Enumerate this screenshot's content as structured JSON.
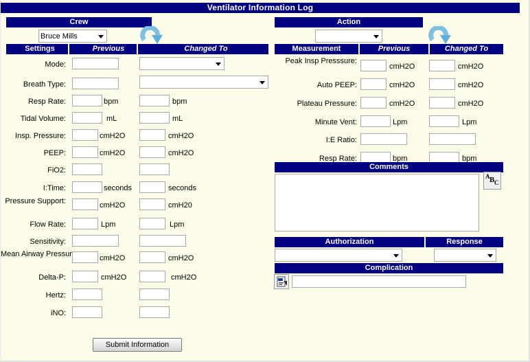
{
  "window": {
    "title": "Ventilator Information Log"
  },
  "crew": {
    "header": "Crew",
    "selected": "Bruce Mills",
    "refresh_icon": "refresh-arrow-icon"
  },
  "action": {
    "header": "Action",
    "selected": "",
    "refresh_icon": "refresh-arrow-icon"
  },
  "settings_table": {
    "headers": {
      "label": "Settings",
      "previous": "Previous",
      "changed": "Changed To"
    },
    "rows": [
      {
        "label": "Mode:",
        "prev_kind": "text",
        "prev_unit": "",
        "chg_kind": "select",
        "chg_unit": "",
        "chg_value": ""
      },
      {
        "label": "Breath Type:",
        "prev_kind": "text",
        "prev_unit": "",
        "chg_kind": "select",
        "chg_unit": "",
        "chg_value": ""
      },
      {
        "label": "Resp Rate:",
        "prev_kind": "text",
        "prev_unit": "bpm",
        "chg_kind": "text",
        "chg_unit": "bpm",
        "chg_value": ""
      },
      {
        "label": "Tidal Volume:",
        "prev_kind": "text",
        "prev_unit": "mL",
        "chg_kind": "text",
        "chg_unit": "mL",
        "chg_value": ""
      },
      {
        "label": "Insp. Pressure:",
        "prev_kind": "text",
        "prev_unit": "cmH2O",
        "chg_kind": "text",
        "chg_unit": "cmH2O",
        "chg_value": ""
      },
      {
        "label": "PEEP:",
        "prev_kind": "text",
        "prev_unit": "cmH2O",
        "chg_kind": "text",
        "chg_unit": "cmH2O",
        "chg_value": ""
      },
      {
        "label": "FiO2:",
        "prev_kind": "text",
        "prev_unit": "",
        "chg_kind": "text",
        "chg_unit": "",
        "chg_value": ""
      },
      {
        "label": "I:Time:",
        "prev_kind": "text",
        "prev_unit": "seconds",
        "chg_kind": "text",
        "chg_unit": "seconds",
        "chg_value": ""
      },
      {
        "label": "Pressure Support:",
        "prev_kind": "text",
        "prev_unit": "cmH2O",
        "chg_kind": "text",
        "chg_unit": "cmH20",
        "chg_value": ""
      },
      {
        "label": "Flow Rate:",
        "prev_kind": "text",
        "prev_unit": "Lpm",
        "chg_kind": "text",
        "chg_unit": "Lpm",
        "chg_value": ""
      },
      {
        "label": "Sensitivity:",
        "prev_kind": "wide",
        "prev_unit": "",
        "chg_kind": "wide",
        "chg_unit": "",
        "chg_value": ""
      },
      {
        "label": "Mean Airway Pressure:",
        "prev_kind": "text",
        "prev_unit": "cmH2O",
        "chg_kind": "text",
        "chg_unit": "cmH2O",
        "chg_value": ""
      },
      {
        "label": "Delta-P:",
        "prev_kind": "text",
        "prev_unit": "cmH2O",
        "chg_kind": "text",
        "chg_unit": "cmH2O",
        "chg_value": ""
      },
      {
        "label": "Hertz:",
        "prev_kind": "text",
        "prev_unit": "",
        "chg_kind": "text",
        "chg_unit": "",
        "chg_value": ""
      },
      {
        "label": "iNO:",
        "prev_kind": "text",
        "prev_unit": "",
        "chg_kind": "text",
        "chg_unit": "",
        "chg_value": ""
      }
    ]
  },
  "measurement_table": {
    "headers": {
      "label": "Measurement",
      "previous": "Previous",
      "changed": "Changed To"
    },
    "rows": [
      {
        "label": "Peak Insp Presssure:",
        "prev_unit": "cmH2O",
        "chg_unit": "cmH2O",
        "prev_kind": "text",
        "chg_kind": "text"
      },
      {
        "label": "Auto PEEP:",
        "prev_unit": "cmH2O",
        "chg_unit": "cmH2O",
        "prev_kind": "text",
        "chg_kind": "text"
      },
      {
        "label": "Plateau Pressure:",
        "prev_unit": "cmH2O",
        "chg_unit": "cmH2O",
        "prev_kind": "text",
        "chg_kind": "text"
      },
      {
        "label": "Minute Vent:",
        "prev_unit": "Lpm",
        "chg_unit": "Lpm",
        "prev_kind": "text",
        "chg_kind": "text"
      },
      {
        "label": "I:E Ratio:",
        "prev_unit": "",
        "chg_unit": "",
        "prev_kind": "wide",
        "chg_kind": "wide"
      },
      {
        "label": "Resp Rate:",
        "prev_unit": "bpm",
        "chg_unit": "bpm",
        "prev_kind": "text",
        "chg_kind": "text"
      }
    ]
  },
  "comments": {
    "header": "Comments",
    "value": "",
    "spellcheck_icon": "abc-spellcheck-icon",
    "spellcheck_letters": {
      "a": "A",
      "b": "B",
      "c": "C"
    }
  },
  "authorization": {
    "header": "Authorization",
    "selected": ""
  },
  "response": {
    "header": "Response",
    "selected": ""
  },
  "complication": {
    "header": "Complication",
    "value": "",
    "picker_icon": "complication-picker-icon"
  },
  "submit": {
    "label": "Submit Information"
  },
  "colors": {
    "header_blue": "#000080",
    "page_background": "#fbfbe8",
    "header_text": "#ffffff",
    "field_border": "#a8a8a8",
    "refresh_arrow": "#69b3d4"
  }
}
